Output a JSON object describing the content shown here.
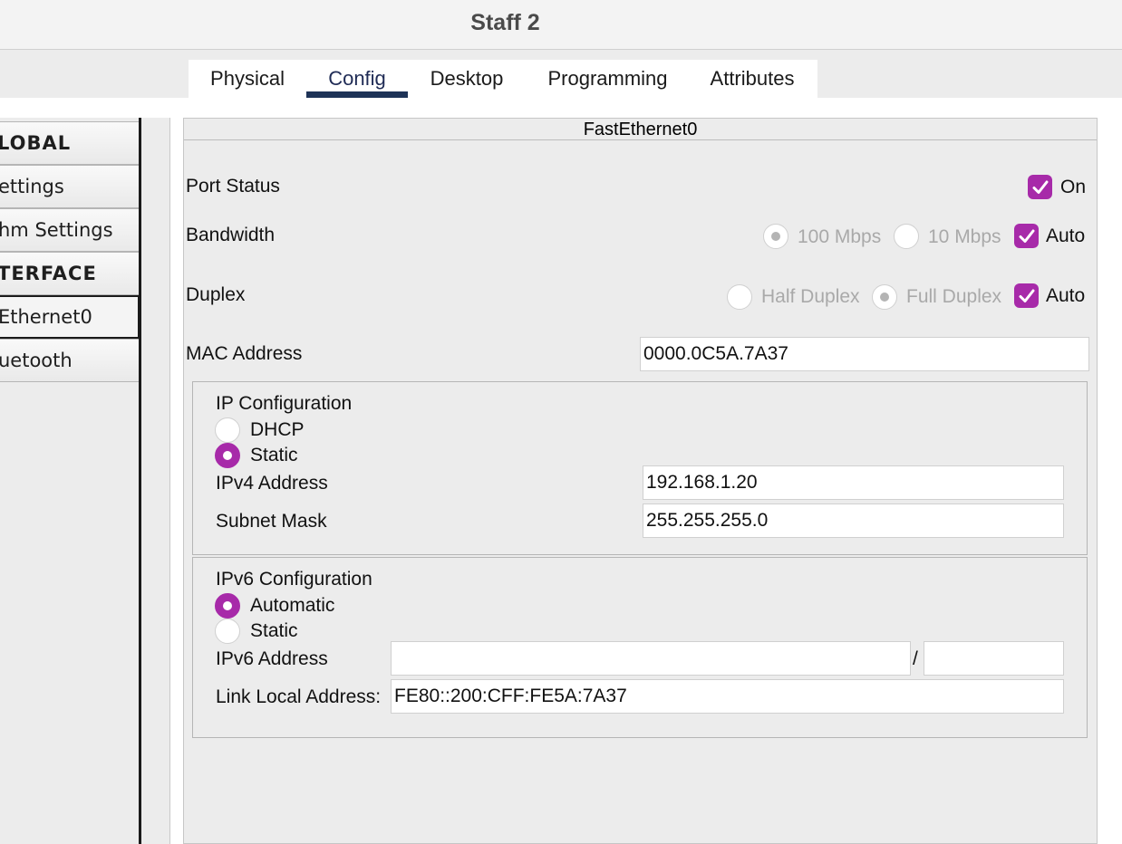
{
  "window": {
    "title": "Staff 2"
  },
  "tabs": [
    {
      "label": "Physical"
    },
    {
      "label": "Config"
    },
    {
      "label": "Desktop"
    },
    {
      "label": "Programming"
    },
    {
      "label": "Attributes"
    }
  ],
  "active_tab": "Config",
  "sidebar": {
    "items": [
      {
        "label": "LOBAL",
        "type": "header"
      },
      {
        "label": "ettings",
        "type": "item"
      },
      {
        "label": "hm Settings",
        "type": "item"
      },
      {
        "label": "TERFACE",
        "type": "header"
      },
      {
        "label": "Ethernet0",
        "type": "item",
        "selected": true
      },
      {
        "label": "uetooth",
        "type": "item"
      }
    ]
  },
  "panel": {
    "title": "FastEthernet0",
    "port_status": {
      "label": "Port Status",
      "checkbox_label": "On",
      "checked": true
    },
    "bandwidth": {
      "label": "Bandwidth",
      "opt_100": "100 Mbps",
      "opt_10": "10 Mbps",
      "auto_label": "Auto",
      "auto_checked": true
    },
    "duplex": {
      "label": "Duplex",
      "opt_half": "Half Duplex",
      "opt_full": "Full Duplex",
      "auto_label": "Auto",
      "auto_checked": true
    },
    "mac": {
      "label": "MAC Address",
      "value": "0000.0C5A.7A37"
    },
    "ipv4": {
      "title": "IP Configuration",
      "dhcp_label": "DHCP",
      "static_label": "Static",
      "mode": "Static",
      "address_label": "IPv4 Address",
      "address_value": "192.168.1.20",
      "mask_label": "Subnet Mask",
      "mask_value": "255.255.255.0"
    },
    "ipv6": {
      "title": "IPv6 Configuration",
      "auto_label": "Automatic",
      "static_label": "Static",
      "mode": "Automatic",
      "address_label": "IPv6 Address",
      "address_value": "",
      "prefix_separator": "/",
      "prefix_value": "",
      "link_local_label": "Link Local Address:",
      "link_local_value": "FE80::200:CFF:FE5A:7A37"
    }
  },
  "colors": {
    "accent": "#a72aa9",
    "tab_underline": "#1e3357"
  }
}
